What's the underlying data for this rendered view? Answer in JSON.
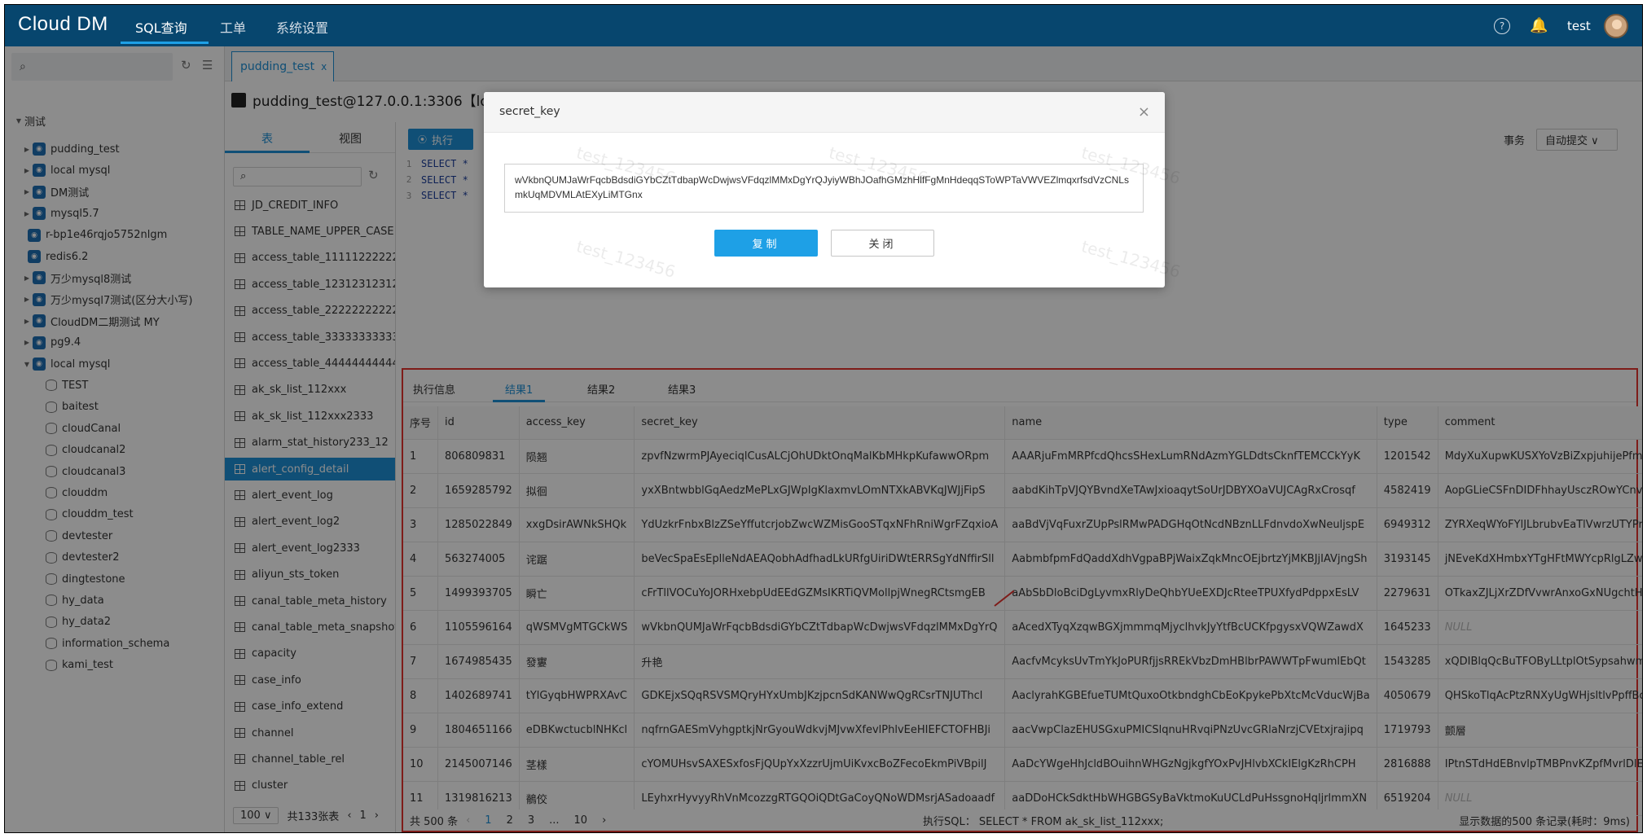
{
  "topbar": {
    "logo": "Cloud DM",
    "nav": [
      "SQL查询",
      "工单",
      "系统设置"
    ],
    "user": "test"
  },
  "sidebar": {
    "root": "测试",
    "items": [
      {
        "label": "pudding_test",
        "type": "conn"
      },
      {
        "label": "local mysql",
        "type": "conn"
      },
      {
        "label": "DM测试",
        "type": "conn"
      },
      {
        "label": "mysql5.7",
        "type": "conn"
      },
      {
        "label": "r-bp1e46rqjo5752nlgm",
        "type": "conn"
      },
      {
        "label": "redis6.2",
        "type": "conn"
      },
      {
        "label": "万少mysql8测试",
        "type": "conn"
      },
      {
        "label": "万少mysql7测试(区分大小写)",
        "type": "conn"
      },
      {
        "label": "CloudDM二期测试 MY",
        "type": "conn"
      },
      {
        "label": "pg9.4",
        "type": "conn"
      },
      {
        "label": "local mysql",
        "type": "conn-open"
      },
      {
        "label": "TEST",
        "type": "db"
      },
      {
        "label": "baitest",
        "type": "db"
      },
      {
        "label": "cloudCanal",
        "type": "db"
      },
      {
        "label": "cloudcanal2",
        "type": "db"
      },
      {
        "label": "cloudcanal3",
        "type": "db"
      },
      {
        "label": "clouddm",
        "type": "db"
      },
      {
        "label": "clouddm_test",
        "type": "db"
      },
      {
        "label": "devtester",
        "type": "db"
      },
      {
        "label": "devtester2",
        "type": "db"
      },
      {
        "label": "dingtestone",
        "type": "db"
      },
      {
        "label": "hy_data",
        "type": "db"
      },
      {
        "label": "hy_data2",
        "type": "db"
      },
      {
        "label": "information_schema",
        "type": "db"
      },
      {
        "label": "kami_test",
        "type": "db"
      }
    ]
  },
  "doc_tab": {
    "label": "pudding_test",
    "close": "x"
  },
  "conn_title": "pudding_test@127.0.0.1:3306【lo",
  "inner_tabs": [
    "表",
    "视图"
  ],
  "tables": [
    "JD_CREDIT_INFO",
    "TABLE_NAME_UPPER_CASE",
    "access_table_11111222222",
    "access_table_12312312312",
    "access_table_22222222222",
    "access_table_33333333333",
    "access_table_44444444444",
    "ak_sk_list_112xxx",
    "ak_sk_list_112xxx2333",
    "alarm_stat_history233_12",
    "alert_config_detail",
    "alert_event_log",
    "alert_event_log2",
    "alert_event_log2333",
    "aliyun_sts_token",
    "canal_table_meta_history",
    "canal_table_meta_snapshot",
    "capacity",
    "case_info",
    "case_info_extend",
    "channel",
    "channel_table_rel",
    "cluster"
  ],
  "table_pager": {
    "size": "100",
    "total": "共133张表",
    "page": "1"
  },
  "editor": {
    "exec_label": "执行",
    "txn_label": "事务",
    "txn_mode": "自动提交",
    "lines": [
      "SELECT *",
      "SELECT *",
      "SELECT *"
    ]
  },
  "results": {
    "tabs": [
      "执行信息",
      "结果1",
      "结果2",
      "结果3"
    ],
    "columns": [
      "序号",
      "id",
      "access_key",
      "secret_key",
      "name",
      "type",
      "comment"
    ],
    "rows": [
      [
        "1",
        "806809831",
        "陨翘",
        "zpvfNzwrmPJAyeciqlCusALCjOhUDktOnqMalKbMHkpKufawwORpm",
        "AAARjuFmMRPfcdQhcsSHexLumRNdAzmYGLDdtsCknfTEMCCkYyK",
        "1201542",
        "MdyXuXupwKUSXYoVzBiZxpjuhijePfmH"
      ],
      [
        "2",
        "1659285792",
        "拟徊",
        "yxXBntwbblGqAedzMePLxGJWpIgKlaxmvLOmNTXkABVKqJWJjFipS",
        "aabdKihTpVJQYBvndXeTAwJxioaqytSoUrJDBYXOaVUJCAgRxCrosqf",
        "4582419",
        "AopGLieCSFnDIDFhhayUsczROwYCnvl"
      ],
      [
        "3",
        "1285022849",
        "xxgDsirAWNkSHQk",
        "YdUzkrFnbxBlzZSeYffutcrjobZwcWZMisGooSTqxNFhRniWgrFZqxioA",
        "aaBdVjVqFuxrZUpPslRMwPADGHqOtNcdNBznLLFdnvdoXwNeuljspE",
        "6949312",
        "ZYRXeqWYoFYlJLbrubvEaTlVwrzUTYPr"
      ],
      [
        "4",
        "563274005",
        "诧踞",
        "beVecSpaEsEplleNdAEAQobhAdfhadLkURfgUiriDWtERRSgYdNffirSll",
        "AabmbfpmFdQaddXdhVgpaBPjWaixZqkMncOEjbrtzYjMKBJjIAVjngSh",
        "3193145",
        "jNEveKdXHmbxYTgHFtMWYcpRlgLZwn"
      ],
      [
        "5",
        "1499393705",
        "瞬亡",
        "cFrTllVOCuYoJORHxebpUdEEdGZMsIKRTiQVMollpjWnegRCtsmgEB",
        "aAbSbDloBciDgLyvmxRlyDeQhbYUeEXDJcRteeTPUXfydPdppxEsLV",
        "2279631",
        "OTkaxZJLjXrZDfVvwrAnxoGxNUgchtH"
      ],
      [
        "6",
        "1105596164",
        "qWSMVgMTGCkWS",
        "wVkbnQUMJaWrFqcbBdsdiGYbCZtTdbapWcDwjwsVFdqzlMMxDgYrQ",
        "aAcedXTyqXzqwBGXjmmmqMjyclhvkJyYtfBcUCKfpgysxVQWZawdX",
        "1645233",
        "NULL"
      ],
      [
        "7",
        "1674985435",
        "發寠",
        "升艳",
        "AacfvMcyksUvTmYkJoPURfjjsRREkVbzDmHBlbrPAWWTpFwumlEbQt",
        "1543285",
        "xQDIBlqQcBuTFOByLLtplOtSypsahwm"
      ],
      [
        "8",
        "1402689741",
        "tYlGyqbHWPRXAvC",
        "GDKEjxSQqRSVSMQryHYxUmbJKzjpcnSdKANWwQgRCsrTNJUThcl",
        "AaclyrahKGBEfueTUMtQuxoOtkbndghCbEoKpykePbXtcMcVducWjBa",
        "4050679",
        "QHSkoTlqAcPtzRNXyUgWHjsltlvPpffBo"
      ],
      [
        "9",
        "1804651166",
        "eDBKwctucblNHKcl",
        "nqfrnGAESmVyhgptkjNrGyouWdkvjMJvwXfevlPhlvEeHIEFCTOFHBJi",
        "aacVwpClazEHUSGxuPMICSlqnuHRvqiPNzUvcGRlaNrzjCVEtxjrajipq",
        "1719793",
        "颤層"
      ],
      [
        "10",
        "2145007146",
        "茎樣",
        "cYOMUHsvSAXESxfosFjQUpYxXzzrUjmUiKvxcBoZFecoEkmPiVBpilJ",
        "AaDcYWgeHhJcldBOuihnWHGzNgjkgfYOxPvJHlvbXCkIElgKzRhCPH",
        "2816888",
        "IPtnSTdHdEBnvlpTMBPnvKZpfMvrlDlEd"
      ],
      [
        "11",
        "1319816213",
        "鶺佼",
        "LEyhxrHyvyyRhVnMcozzgRTGQOiQDtGaCoyQNoWDMsrjASadoaadf",
        "aaDDoHCkSdktHbWHGBGSyBaVktmoKuUCLdPuHssgnoHqljrlmmXN",
        "6519204",
        "NULL"
      ]
    ],
    "footer": {
      "total": "共 500 条",
      "pages": [
        "1",
        "2",
        "3",
        "...",
        "10"
      ],
      "sql": "执行SQL：  SELECT * FROM ak_sk_list_112xxx;",
      "stat": "显示数据的500 条记录(耗时：9ms)"
    }
  },
  "modal": {
    "title": "secret_key",
    "close": "×",
    "value": "wVkbnQUMJaWrFqcbBdsdiGYbCZtTdbapWcDwjwsVFdqzlMMxDgYrQJyiyWBhJOafhGMzhHlfFgMnHdeqqSToWPTaVWVEZlmqxrfsdVzCNLsmkUqMDVMLAtEXyLiMTGnx",
    "copy_label": "复制",
    "close_label": "关闭"
  },
  "watermark": "test_123456"
}
